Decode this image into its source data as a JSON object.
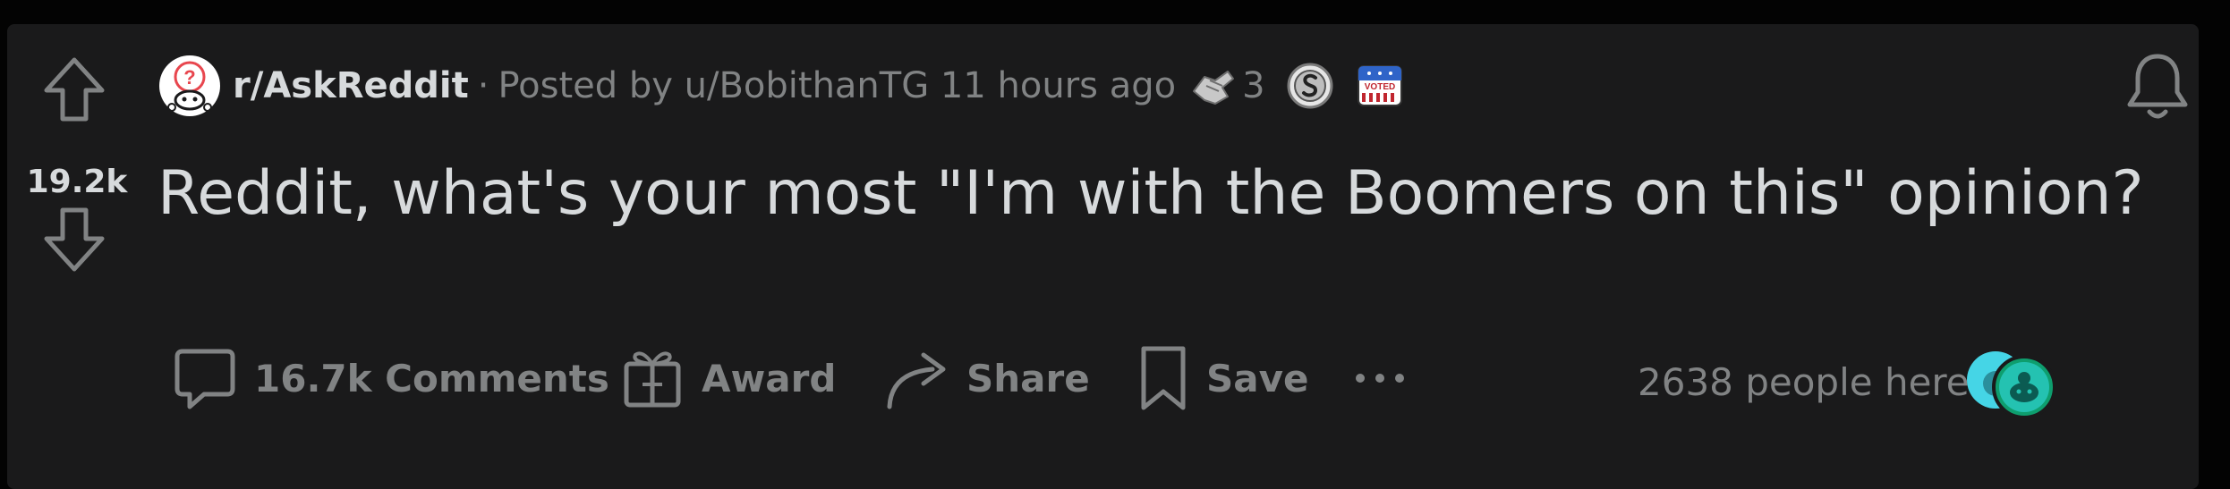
{
  "post": {
    "vote_count": "19.2k",
    "subreddit": "r/AskReddit",
    "separator": "·",
    "posted_by": "Posted by u/BobithanTG 11 hours ago",
    "award_count": "3",
    "title": "Reddit, what's your most \"I'm with the Boomers on this\" opinion?"
  },
  "awards": [
    {
      "icon": "helping-hand-award-icon",
      "count": "3"
    },
    {
      "icon": "silver-award-icon"
    },
    {
      "icon": "voted-award-icon",
      "label": "VOTED"
    }
  ],
  "actions": {
    "comments": "16.7k Comments",
    "award": "Award",
    "share": "Share",
    "save": "Save",
    "more_icon": "more-options-icon"
  },
  "online": {
    "text": "2638 people here"
  },
  "icons": {
    "upvote": "upvote-arrow-icon",
    "downvote": "downvote-arrow-icon",
    "subreddit": "askreddit-snoo-icon",
    "notify": "bell-icon"
  },
  "colors": {
    "page_bg": "#030303",
    "card_bg": "#1a1a1b",
    "primary_text": "#d7dadc",
    "muted_text": "#818384",
    "online_teal": "#24c2b1"
  }
}
